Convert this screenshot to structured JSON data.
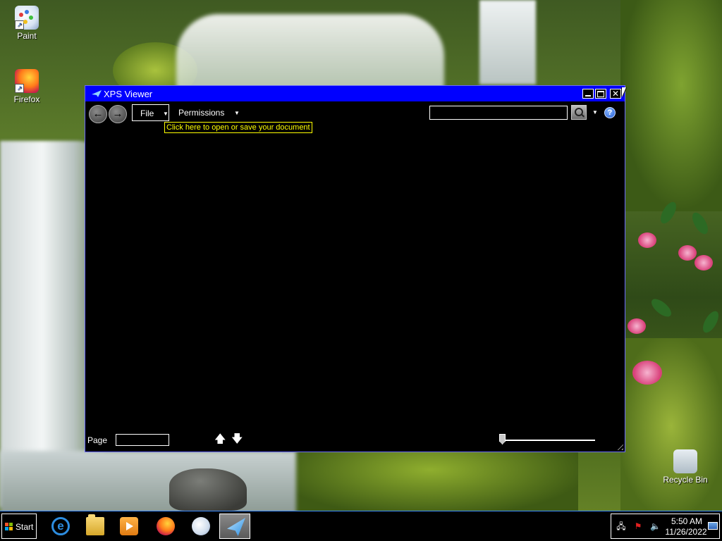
{
  "desktop": {
    "icons": [
      {
        "label": "Paint",
        "icon": "paint-icon"
      },
      {
        "label": "Firefox",
        "icon": "firefox-icon"
      },
      {
        "label": "Recycle Bin",
        "icon": "recycle-bin-icon"
      }
    ]
  },
  "window": {
    "title": "XPS Viewer",
    "title_icon": "xps-viewer-icon",
    "colors": {
      "titlebar": "#0000ff",
      "background": "#000000",
      "text": "#ffffff",
      "tooltip": "#ffff00"
    },
    "controls": {
      "minimize": "minimize-icon",
      "maximize": "maximize-icon",
      "close": "close-icon"
    }
  },
  "toolbar": {
    "back_icon": "back-arrow-icon",
    "forward_icon": "forward-arrow-icon",
    "file_label": "File",
    "permissions_label": "Permissions",
    "tooltip": "Click here to open or save your document",
    "search_value": "",
    "search_icon": "search-icon",
    "help_icon": "help-icon",
    "help_glyph": "?"
  },
  "statusbar": {
    "page_label": "Page",
    "page_value": "",
    "prev_icon": "up-arrow-icon",
    "next_icon": "down-arrow-icon",
    "zoom_level_fraction": 0.0
  },
  "taskbar": {
    "start_label": "Start",
    "apps": [
      {
        "name": "Internet Explorer",
        "icon": "internet-explorer-icon",
        "active": false
      },
      {
        "name": "File Explorer",
        "icon": "folder-icon",
        "active": false
      },
      {
        "name": "Windows Media Player",
        "icon": "media-player-icon",
        "active": false
      },
      {
        "name": "Firefox",
        "icon": "firefox-icon",
        "active": false
      },
      {
        "name": "Paint",
        "icon": "paint-icon",
        "active": false
      },
      {
        "name": "XPS Viewer",
        "icon": "xps-viewer-icon",
        "active": true
      }
    ],
    "tray": {
      "time": "5:50 AM",
      "date": "11/26/2022",
      "icons": [
        "network-icon",
        "action-center-flag-icon",
        "volume-icon",
        "show-desktop-icon"
      ]
    }
  }
}
